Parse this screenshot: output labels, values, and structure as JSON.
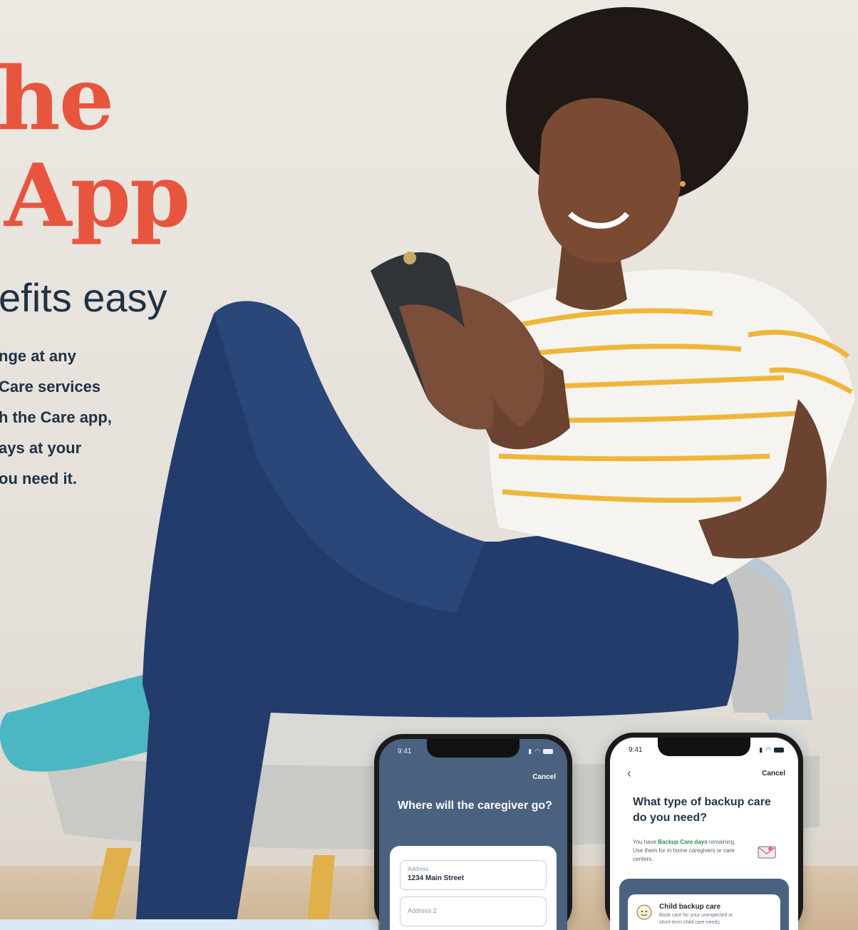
{
  "hero": {
    "title_line1": "he",
    "title_line2": "App",
    "subtitle": "efits easy",
    "body_lines": [
      "nge at any",
      "Care services",
      "h the Care app,",
      "ays at your",
      "ou need it."
    ]
  },
  "phone_address": {
    "time": "9:41",
    "cancel": "Cancel",
    "title": "Where will the caregiver go?",
    "fields": [
      {
        "label": "Address",
        "value": "1234 Main Street"
      },
      {
        "placeholder": "Address 2"
      }
    ]
  },
  "phone_care_type": {
    "time": "9:41",
    "cancel": "Cancel",
    "title": "What type of backup care do you need?",
    "info_prefix": "You have ",
    "info_highlight": "Backup Care days",
    "info_suffix": " remaining. Use them for in home caregivers or care centers.",
    "option": {
      "title": "Child backup care",
      "description": "Book care for your unexpected or short-term child care needs"
    }
  },
  "colors": {
    "title_accent": "#e8553f",
    "text_dark": "#1f3145",
    "app_navy": "#4a6180",
    "highlight_green": "#2e8b4e"
  }
}
